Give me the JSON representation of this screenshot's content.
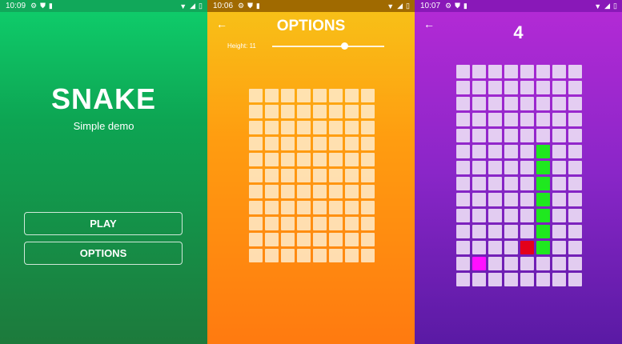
{
  "status_bars": [
    {
      "time": "10:09"
    },
    {
      "time": "10:06"
    },
    {
      "time": "10:07"
    }
  ],
  "menu_screen": {
    "title": "SNAKE",
    "subtitle": "Simple demo",
    "play_label": "PLAY",
    "options_label": "OPTIONS"
  },
  "options_screen": {
    "title": "OPTIONS",
    "slider_label": "Height: 11",
    "slider_value": 0.64,
    "grid": {
      "cols": 8,
      "rows": 11
    }
  },
  "game_screen": {
    "score": "4",
    "grid": {
      "cols": 8,
      "rows": 14
    },
    "snake_color": "#1fe81f",
    "food_color": "#ff10ff",
    "head_color": "#e4001a",
    "snake_cells": [
      [
        5,
        5
      ],
      [
        5,
        6
      ],
      [
        5,
        7
      ],
      [
        5,
        8
      ],
      [
        5,
        9
      ],
      [
        5,
        10
      ],
      [
        5,
        11
      ]
    ],
    "head_cell": [
      4,
      11
    ],
    "food_cell": [
      1,
      12
    ]
  },
  "icons": {
    "status": [
      "gear-icon",
      "shield-icon",
      "sim-icon",
      "wifi-icon",
      "signal-icon",
      "battery-icon"
    ],
    "back": "back-arrow-icon"
  },
  "colors": {
    "menu_bg": "#0da553",
    "options_bg": "#ff9d10",
    "game_bg": "#8a26c8"
  }
}
